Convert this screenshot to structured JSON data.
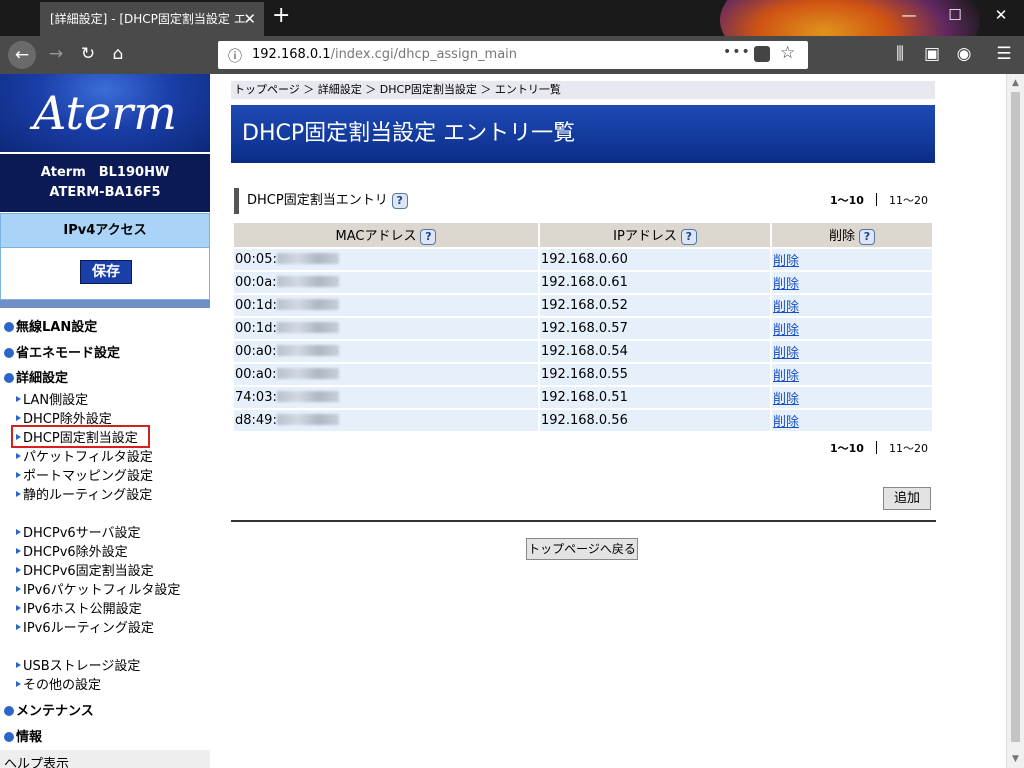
{
  "browser": {
    "tab_title": "[詳細設定] - [DHCP固定割当設定 エ",
    "tab_close": "✕",
    "new_tab": "+",
    "url_host": "192.168.0.1",
    "url_path": "/index.cgi/dhcp_assign_main",
    "url_dots": "•••",
    "window_minimize": "—",
    "window_maximize": "☐",
    "window_close": "✕"
  },
  "sidebar": {
    "logo_text": "Aterm",
    "model_line1": "Aterm　BL190HW",
    "model_line2": "ATERM-BA16F5",
    "access_mode": "IPv4アクセス",
    "save_label": "保存",
    "menu": {
      "wireless": "無線LAN設定",
      "eco": "省エネモード設定",
      "advanced": "詳細設定",
      "maintenance": "メンテナンス",
      "info": "情報",
      "help": "ヘルプ表示"
    },
    "sub": [
      "LAN側設定",
      "DHCP除外設定",
      "DHCP固定割当設定",
      "パケットフィルタ設定",
      "ポートマッピング設定",
      "静的ルーティング設定",
      "DHCPv6サーバ設定",
      "DHCPv6除外設定",
      "DHCPv6固定割当設定",
      "IPv6パケットフィルタ設定",
      "IPv6ホスト公開設定",
      "IPv6ルーティング設定",
      "USBストレージ設定",
      "その他の設定"
    ]
  },
  "main": {
    "breadcrumb": "トップページ ＞ 詳細設定 ＞ DHCP固定割当設定 ＞ エントリ一覧",
    "page_title": "DHCP固定割当設定 エントリ一覧",
    "section_title": "DHCP固定割当エントリ",
    "help_glyph": "?",
    "pager_current": "1〜10",
    "pager_next": "11〜20",
    "table": {
      "headers": [
        "MACアドレス",
        "IPアドレス",
        "削除"
      ],
      "rows": [
        {
          "mac": "00:05:",
          "ip": "192.168.0.60",
          "action": "削除"
        },
        {
          "mac": "00:0a:",
          "ip": "192.168.0.61",
          "action": "削除"
        },
        {
          "mac": "00:1d:",
          "ip": "192.168.0.52",
          "action": "削除"
        },
        {
          "mac": "00:1d:",
          "ip": "192.168.0.57",
          "action": "削除"
        },
        {
          "mac": "00:a0:",
          "ip": "192.168.0.54",
          "action": "削除"
        },
        {
          "mac": "00:a0:",
          "ip": "192.168.0.55",
          "action": "削除"
        },
        {
          "mac": "74:03:",
          "ip": "192.168.0.51",
          "action": "削除"
        },
        {
          "mac": "d8:49:",
          "ip": "192.168.0.56",
          "action": "削除"
        }
      ]
    },
    "add_label": "追加",
    "back_label": "トップページへ戻る"
  }
}
